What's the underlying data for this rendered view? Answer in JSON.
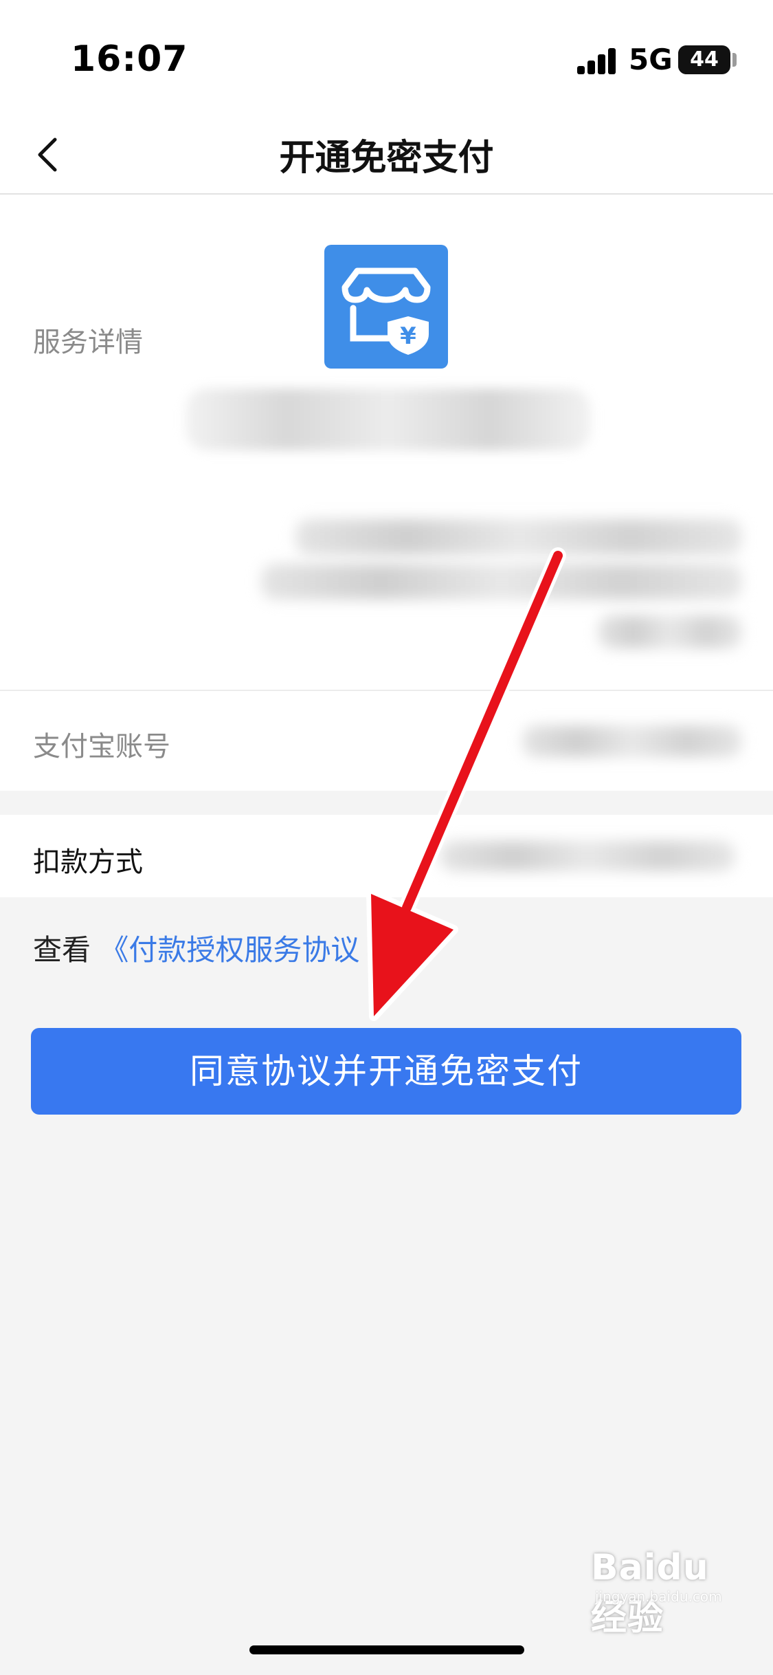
{
  "status_bar": {
    "time": "16:07",
    "network": "5G",
    "battery": "44"
  },
  "nav": {
    "title": "开通免密支付",
    "back_icon": "chevron-left-icon"
  },
  "header": {
    "app_logo_icon": "store-shield-yuan-icon",
    "logo_color": "#3f8ee8"
  },
  "details": {
    "service_label": "服务详情",
    "account_label": "支付宝账号",
    "payment_method_label": "扣款方式"
  },
  "agreement": {
    "prefix": "查看",
    "link_text": "《付款授权服务协议"
  },
  "submit_button": {
    "label": "同意协议并开通免密支付",
    "color": "#3878f0"
  },
  "annotation": {
    "arrow_color": "#e8121b"
  },
  "watermark": {
    "brand": "Baidu经验",
    "url": "jingyan.baidu.com"
  },
  "colors": {
    "link": "#3a7ae6",
    "background": "#f4f4f4"
  }
}
